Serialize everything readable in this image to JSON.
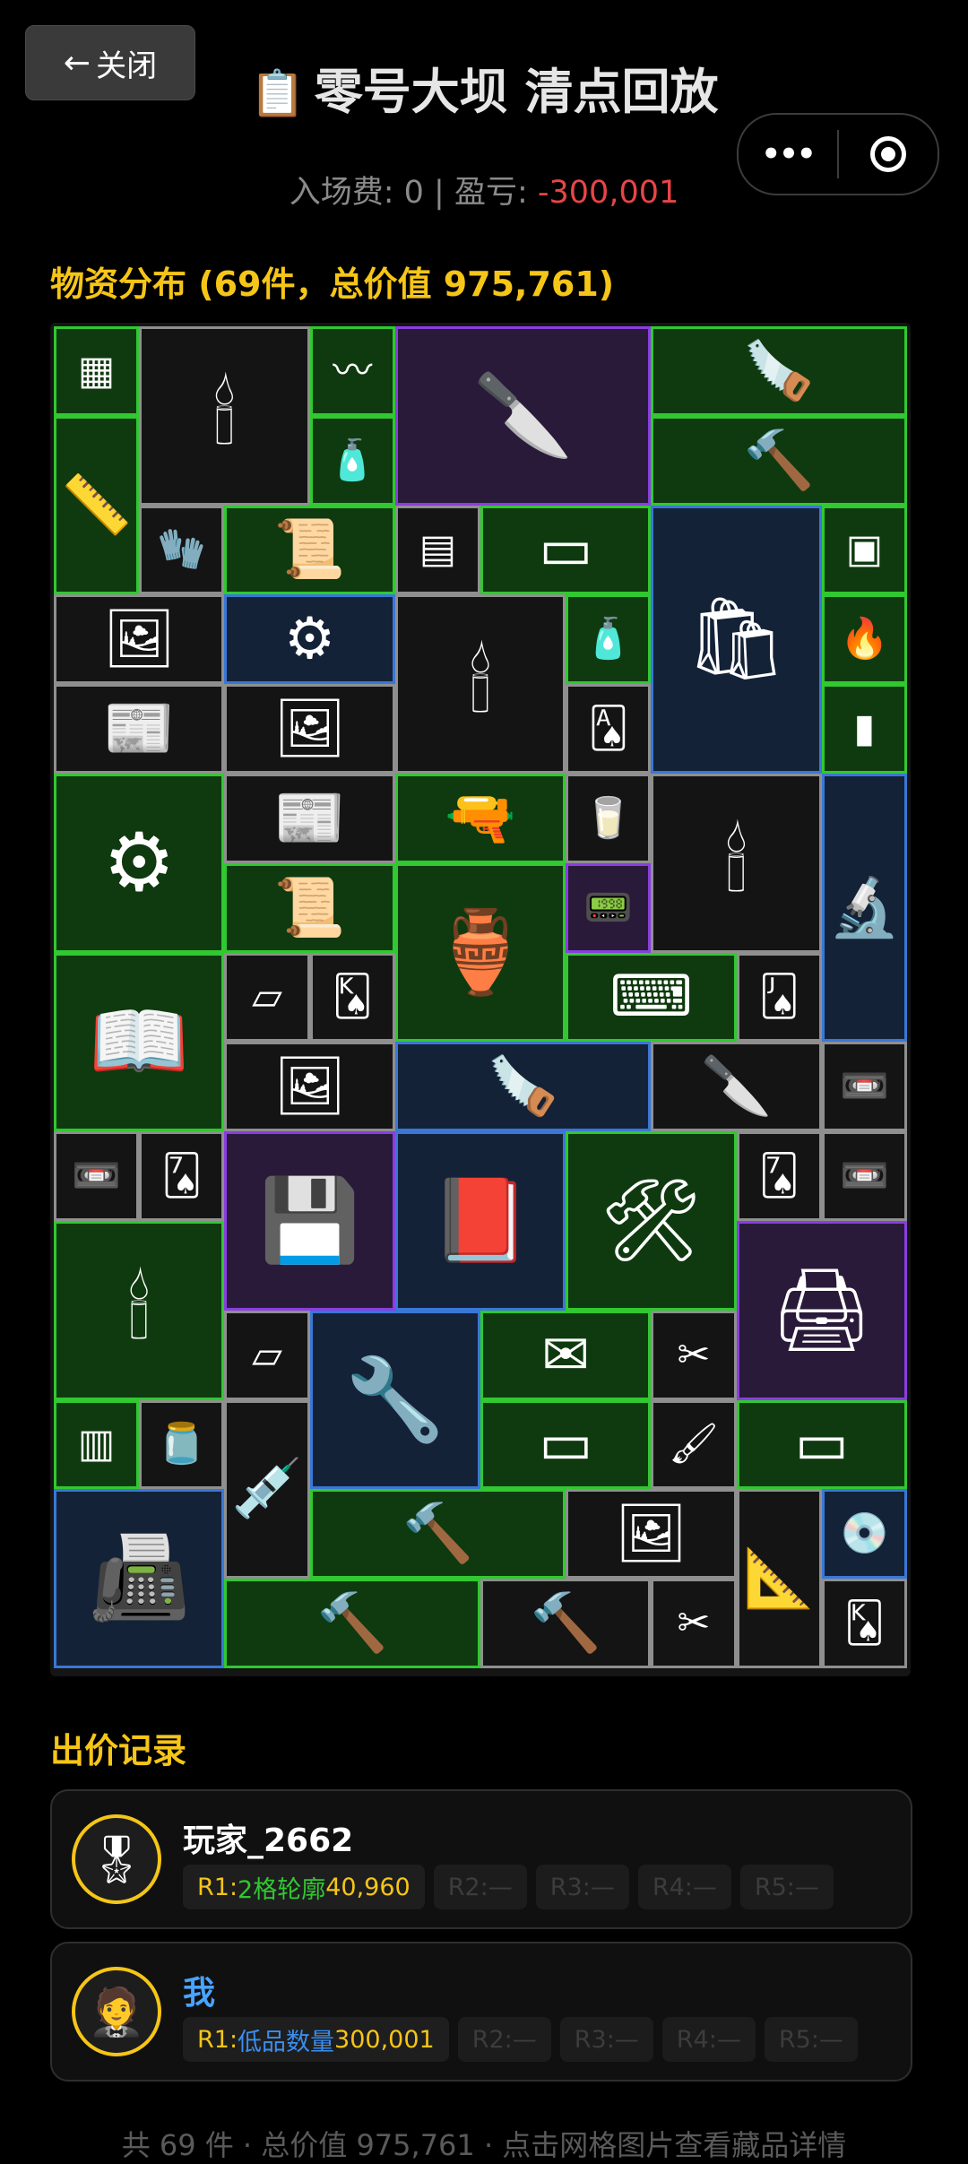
{
  "header": {
    "close_label": "关闭",
    "title_icon": "📋",
    "title": "零号大坝 清点回放",
    "more_icon": "•••"
  },
  "stats": {
    "entry_label": "入场费: 0 | 盈亏: ",
    "loss_value": "-300,001"
  },
  "inventory": {
    "section_title": "物资分布 (69件，总价值 975,761)",
    "items": [
      {
        "name": "circuit-board",
        "icon": "▦",
        "quality": "green",
        "c": 0,
        "r": 0,
        "w": 1,
        "h": 1
      },
      {
        "name": "candle-box",
        "icon": "🕯",
        "quality": "gray",
        "c": 1,
        "r": 0,
        "w": 2,
        "h": 2
      },
      {
        "name": "fuse-wire",
        "icon": "〰",
        "quality": "green",
        "c": 3,
        "r": 0,
        "w": 1,
        "h": 1
      },
      {
        "name": "knife",
        "icon": "🔪",
        "quality": "purple",
        "c": 4,
        "r": 0,
        "w": 3,
        "h": 2
      },
      {
        "name": "hacksaw",
        "icon": "🪚",
        "quality": "green",
        "c": 7,
        "r": 0,
        "w": 3,
        "h": 1
      },
      {
        "name": "level-tool",
        "icon": "📏",
        "quality": "green",
        "c": 0,
        "r": 1,
        "w": 1,
        "h": 2
      },
      {
        "name": "glue",
        "icon": "🧴",
        "quality": "green",
        "c": 3,
        "r": 1,
        "w": 1,
        "h": 1
      },
      {
        "name": "sledgehammer",
        "icon": "🔨",
        "quality": "green",
        "c": 7,
        "r": 1,
        "w": 3,
        "h": 1
      },
      {
        "name": "gloves",
        "icon": "🧤",
        "quality": "gray",
        "c": 1,
        "r": 2,
        "w": 1,
        "h": 1
      },
      {
        "name": "old-map",
        "icon": "📜",
        "quality": "green",
        "c": 2,
        "r": 2,
        "w": 2,
        "h": 1
      },
      {
        "name": "matchbox",
        "icon": "▤",
        "quality": "gray",
        "c": 4,
        "r": 2,
        "w": 1,
        "h": 1
      },
      {
        "name": "wood-plank",
        "icon": "▭",
        "quality": "green",
        "c": 5,
        "r": 2,
        "w": 2,
        "h": 1
      },
      {
        "name": "cement-bag",
        "icon": "🛍",
        "quality": "blue",
        "c": 7,
        "r": 2,
        "w": 2,
        "h": 3
      },
      {
        "name": "ration",
        "icon": "▣",
        "quality": "green",
        "c": 9,
        "r": 2,
        "w": 1,
        "h": 1
      },
      {
        "name": "photo",
        "icon": "🖼",
        "quality": "gray",
        "c": 0,
        "r": 3,
        "w": 2,
        "h": 1
      },
      {
        "name": "rifle-parts",
        "icon": "⚙",
        "quality": "blue",
        "c": 2,
        "r": 3,
        "w": 2,
        "h": 1
      },
      {
        "name": "candle-box-2",
        "icon": "🕯",
        "quality": "gray",
        "c": 4,
        "r": 3,
        "w": 2,
        "h": 2
      },
      {
        "name": "water-bottle",
        "icon": "🧴",
        "quality": "green",
        "c": 6,
        "r": 3,
        "w": 1,
        "h": 1
      },
      {
        "name": "lighter",
        "icon": "🔥",
        "quality": "green",
        "c": 9,
        "r": 3,
        "w": 1,
        "h": 1
      },
      {
        "name": "newspaper",
        "icon": "📰",
        "quality": "gray",
        "c": 0,
        "r": 4,
        "w": 2,
        "h": 1
      },
      {
        "name": "family-photo",
        "icon": "🖼",
        "quality": "gray",
        "c": 2,
        "r": 4,
        "w": 2,
        "h": 1
      },
      {
        "name": "playing-card",
        "icon": "🂡",
        "quality": "gray",
        "c": 6,
        "r": 4,
        "w": 1,
        "h": 1
      },
      {
        "name": "pipe",
        "icon": "▮",
        "quality": "green",
        "c": 9,
        "r": 4,
        "w": 1,
        "h": 1
      },
      {
        "name": "power-supply",
        "icon": "⚙",
        "quality": "green",
        "c": 0,
        "r": 5,
        "w": 2,
        "h": 2
      },
      {
        "name": "newspaper-2",
        "icon": "📰",
        "quality": "gray",
        "c": 2,
        "r": 5,
        "w": 2,
        "h": 1
      },
      {
        "name": "glue-gun",
        "icon": "🔫",
        "quality": "green",
        "c": 4,
        "r": 5,
        "w": 2,
        "h": 1
      },
      {
        "name": "yogurt-cup",
        "icon": "🥛",
        "quality": "gray",
        "c": 6,
        "r": 5,
        "w": 1,
        "h": 1
      },
      {
        "name": "candle-box-3",
        "icon": "🕯",
        "quality": "gray",
        "c": 7,
        "r": 5,
        "w": 2,
        "h": 2
      },
      {
        "name": "microscope",
        "icon": "🔬",
        "quality": "blue",
        "c": 9,
        "r": 5,
        "w": 1,
        "h": 3
      },
      {
        "name": "old-paper",
        "icon": "📜",
        "quality": "green",
        "c": 2,
        "r": 6,
        "w": 2,
        "h": 1
      },
      {
        "name": "tagine",
        "icon": "🏺",
        "quality": "green",
        "c": 4,
        "r": 6,
        "w": 2,
        "h": 2
      },
      {
        "name": "gadget",
        "icon": "📟",
        "quality": "purple",
        "c": 6,
        "r": 6,
        "w": 1,
        "h": 1
      },
      {
        "name": "magazine",
        "icon": "📖",
        "quality": "green",
        "c": 0,
        "r": 7,
        "w": 2,
        "h": 2
      },
      {
        "name": "tissue",
        "icon": "▱",
        "quality": "gray",
        "c": 2,
        "r": 7,
        "w": 1,
        "h": 1
      },
      {
        "name": "card-king",
        "icon": "🂮",
        "quality": "gray",
        "c": 3,
        "r": 7,
        "w": 1,
        "h": 1
      },
      {
        "name": "keyboard",
        "icon": "⌨",
        "quality": "green",
        "c": 6,
        "r": 7,
        "w": 2,
        "h": 1
      },
      {
        "name": "card-jack",
        "icon": "🂫",
        "quality": "gray",
        "c": 8,
        "r": 7,
        "w": 1,
        "h": 1
      },
      {
        "name": "photo-2",
        "icon": "🖼",
        "quality": "gray",
        "c": 2,
        "r": 8,
        "w": 2,
        "h": 1
      },
      {
        "name": "bone-saw",
        "icon": "🪚",
        "quality": "blue",
        "c": 4,
        "r": 8,
        "w": 3,
        "h": 1
      },
      {
        "name": "utility-knife",
        "icon": "🔪",
        "quality": "gray",
        "c": 7,
        "r": 8,
        "w": 2,
        "h": 1
      },
      {
        "name": "tape-measure",
        "icon": "📼",
        "quality": "gray",
        "c": 9,
        "r": 8,
        "w": 1,
        "h": 1
      },
      {
        "name": "tape-measure-2",
        "icon": "📼",
        "quality": "gray",
        "c": 0,
        "r": 9,
        "w": 1,
        "h": 1
      },
      {
        "name": "card-spades",
        "icon": "🂧",
        "quality": "gray",
        "c": 1,
        "r": 9,
        "w": 1,
        "h": 1
      },
      {
        "name": "hard-drive",
        "icon": "💾",
        "quality": "purple",
        "c": 2,
        "r": 9,
        "w": 2,
        "h": 2
      },
      {
        "name": "fashion-magazine",
        "icon": "📕",
        "quality": "blue",
        "c": 4,
        "r": 9,
        "w": 2,
        "h": 2
      },
      {
        "name": "angle-grinder",
        "icon": "🛠",
        "quality": "green",
        "c": 6,
        "r": 9,
        "w": 2,
        "h": 2
      },
      {
        "name": "card-spades-2",
        "icon": "🂧",
        "quality": "gray",
        "c": 8,
        "r": 9,
        "w": 1,
        "h": 1
      },
      {
        "name": "tape-measure-3",
        "icon": "📼",
        "quality": "gray",
        "c": 9,
        "r": 9,
        "w": 1,
        "h": 1
      },
      {
        "name": "candle-box-4",
        "icon": "🕯",
        "quality": "green",
        "c": 0,
        "r": 10,
        "w": 2,
        "h": 2
      },
      {
        "name": "lab-incubator",
        "icon": "🖨",
        "quality": "purple",
        "c": 8,
        "r": 10,
        "w": 2,
        "h": 2
      },
      {
        "name": "tissue-2",
        "icon": "▱",
        "quality": "gray",
        "c": 2,
        "r": 11,
        "w": 1,
        "h": 1
      },
      {
        "name": "power-drill",
        "icon": "🔧",
        "quality": "blue",
        "c": 3,
        "r": 11,
        "w": 2,
        "h": 2
      },
      {
        "name": "letters",
        "icon": "✉",
        "quality": "green",
        "c": 5,
        "r": 11,
        "w": 2,
        "h": 1
      },
      {
        "name": "scissors",
        "icon": "✂",
        "quality": "gray",
        "c": 7,
        "r": 11,
        "w": 1,
        "h": 1
      },
      {
        "name": "cpu-cooler",
        "icon": "▥",
        "quality": "green",
        "c": 0,
        "r": 12,
        "w": 1,
        "h": 1
      },
      {
        "name": "protein-jar",
        "icon": "🫙",
        "quality": "gray",
        "c": 1,
        "r": 12,
        "w": 1,
        "h": 1
      },
      {
        "name": "syringe-tool",
        "icon": "💉",
        "quality": "gray",
        "c": 2,
        "r": 12,
        "w": 1,
        "h": 2
      },
      {
        "name": "wood-plank-2",
        "icon": "▭",
        "quality": "green",
        "c": 5,
        "r": 12,
        "w": 2,
        "h": 1
      },
      {
        "name": "paint-brush",
        "icon": "🖌",
        "quality": "gray",
        "c": 7,
        "r": 12,
        "w": 1,
        "h": 1
      },
      {
        "name": "wood-plank-3",
        "icon": "▭",
        "quality": "green",
        "c": 8,
        "r": 12,
        "w": 2,
        "h": 1
      },
      {
        "name": "air-purifier",
        "icon": "📠",
        "quality": "blue",
        "c": 0,
        "r": 13,
        "w": 2,
        "h": 2
      },
      {
        "name": "sledgehammer-2",
        "icon": "🔨",
        "quality": "green",
        "c": 3,
        "r": 13,
        "w": 3,
        "h": 1
      },
      {
        "name": "family-photo-2",
        "icon": "🖼",
        "quality": "gray",
        "c": 6,
        "r": 13,
        "w": 2,
        "h": 1
      },
      {
        "name": "steel-square",
        "icon": "📐",
        "quality": "gray",
        "c": 8,
        "r": 13,
        "w": 1,
        "h": 2
      },
      {
        "name": "cd-disc",
        "icon": "💿",
        "quality": "blue",
        "c": 9,
        "r": 13,
        "w": 1,
        "h": 1
      },
      {
        "name": "sledgehammer-3",
        "icon": "🔨",
        "quality": "green",
        "c": 2,
        "r": 14,
        "w": 3,
        "h": 1
      },
      {
        "name": "hammer",
        "icon": "🔨",
        "quality": "gray",
        "c": 5,
        "r": 14,
        "w": 2,
        "h": 1
      },
      {
        "name": "scissors-2",
        "icon": "✂",
        "quality": "gray",
        "c": 7,
        "r": 14,
        "w": 1,
        "h": 1
      },
      {
        "name": "card-king-2",
        "icon": "🂮",
        "quality": "gray",
        "c": 9,
        "r": 14,
        "w": 1,
        "h": 1
      }
    ]
  },
  "bids": {
    "section_title": "出价记录",
    "players": [
      {
        "name": "玩家_2662",
        "avatar_icon": "🎖",
        "rounds": [
          {
            "prefix": "R1:",
            "label": "2格轮廓",
            "value": " 40,960",
            "active": true
          },
          {
            "prefix": "R2:",
            "label": "—",
            "value": "",
            "active": false
          },
          {
            "prefix": "R3:",
            "label": "—",
            "value": "",
            "active": false
          },
          {
            "prefix": "R4:",
            "label": "—",
            "value": "",
            "active": false
          },
          {
            "prefix": "R5:",
            "label": "—",
            "value": "",
            "active": false
          }
        ]
      },
      {
        "name": "我",
        "avatar_icon": "🤵",
        "rounds": [
          {
            "prefix": "R1:",
            "label": "低品数量",
            "value": " 300,001",
            "active": true
          },
          {
            "prefix": "R2:",
            "label": "—",
            "value": "",
            "active": false
          },
          {
            "prefix": "R3:",
            "label": "—",
            "value": "",
            "active": false
          },
          {
            "prefix": "R4:",
            "label": "—",
            "value": "",
            "active": false
          },
          {
            "prefix": "R5:",
            "label": "—",
            "value": "",
            "active": false
          }
        ]
      }
    ]
  },
  "footer": "共 69 件 · 总价值 975,761 · 点击网格图片查看藏品详情"
}
